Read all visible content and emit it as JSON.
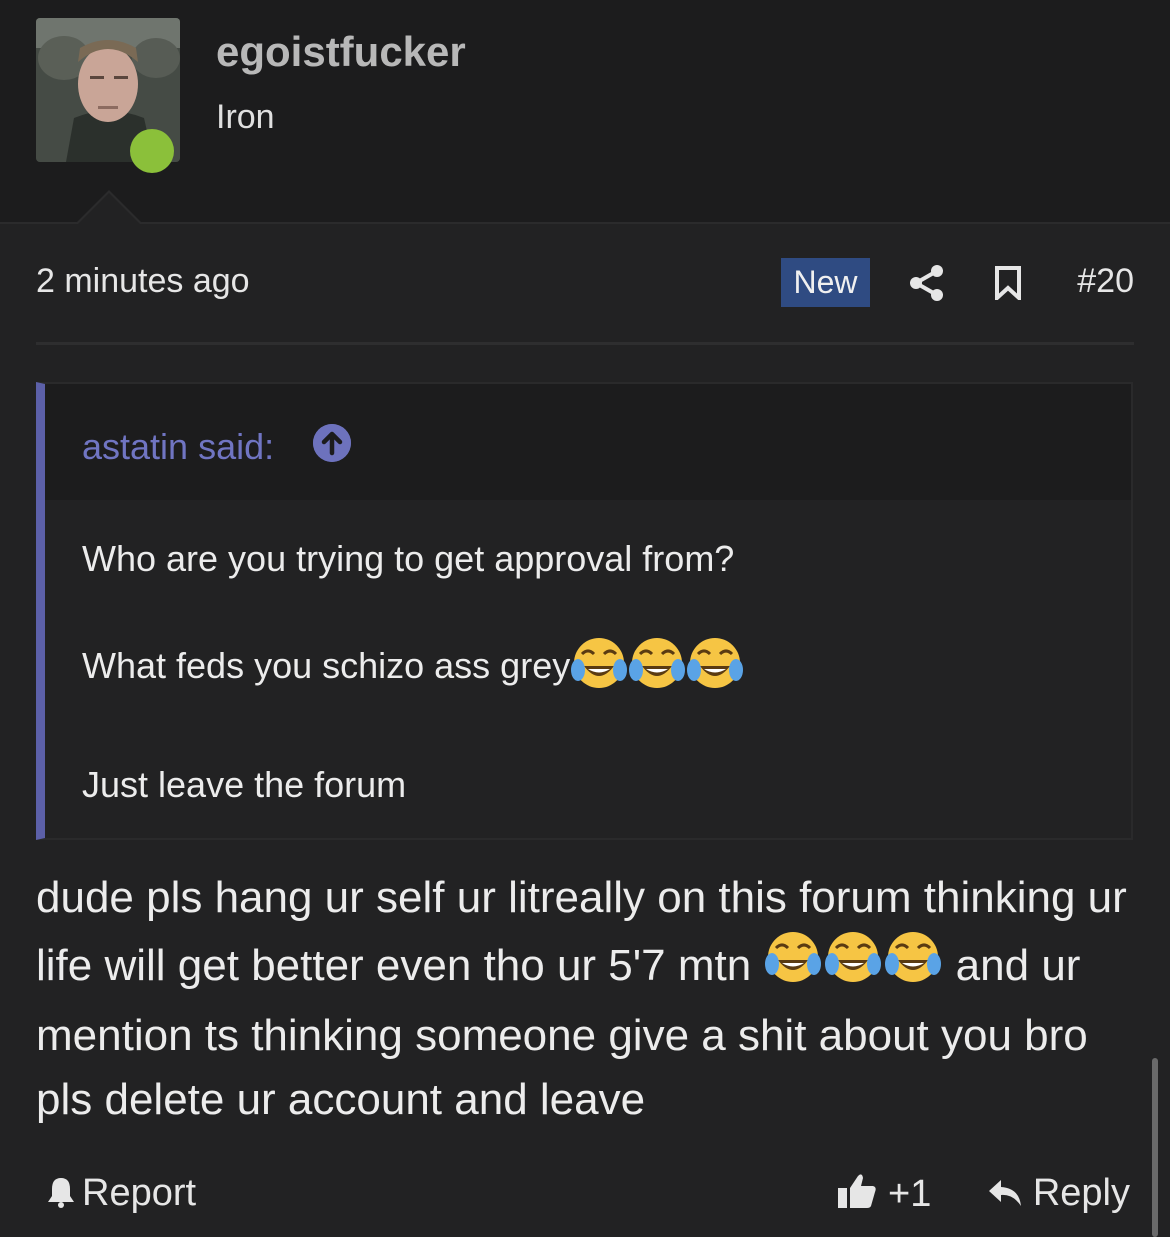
{
  "user": {
    "username": "egoistfucker",
    "title": "Iron",
    "online_color": "#8bc03a"
  },
  "post": {
    "time": "2 minutes ago",
    "new_badge": "New",
    "number": "#20",
    "share_icon": "share-icon",
    "bookmark_icon": "bookmark-icon"
  },
  "quote": {
    "author": "astatin said:",
    "lines": [
      "Who are you trying to get approval from?",
      "What feds you schizo ass grey",
      "Just leave the forum"
    ],
    "accent": "#5c60a8"
  },
  "body": {
    "part1": "dude pls hang ur self ur litreally on this forum thinking ur life will get better even tho ur 5'7 mtn ",
    "part2": " and ur mention ts thinking someone give a shit about you bro pls delete ur account and leave"
  },
  "actions": {
    "report": "Report",
    "like_count": "+1",
    "reply": "Reply"
  }
}
